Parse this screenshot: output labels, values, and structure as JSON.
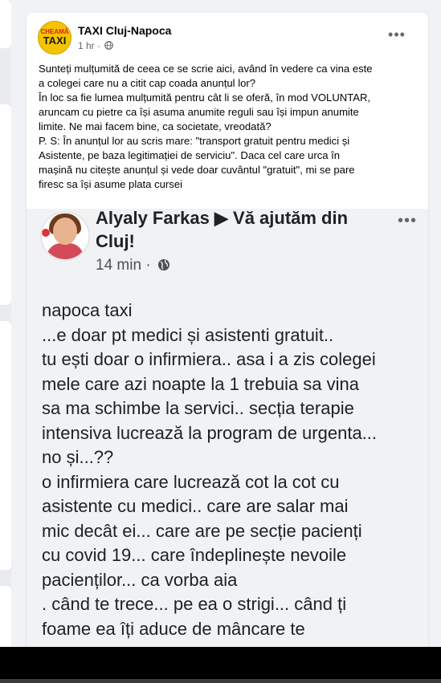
{
  "post": {
    "page_name": "TAXI Cluj-Napoca",
    "time": "1 hr",
    "privacy_icon": "globe-icon",
    "more_icon": "more-horizontal-icon",
    "more_label": "•••",
    "logo": {
      "top_text": "CHEAMĂ",
      "bottom_text": "TAXI",
      "color": "#f5c400"
    },
    "text": "Sunteți mulțumită de ceea ce se scrie aici, având în vedere ca vina este\na colegei care nu a citit cap coada anunțul lor?\nÎn loc sa fie lumea mulțumită pentru cât li se oferă, în mod VOLUNTAR,\naruncam cu pietre ca își asuma anumite reguli sau își impun anumite\nlimite. Ne mai facem bine, ca societate, vreodată?\nP. S: În anunțul lor au scris mare: \"transport gratuit pentru medici și\nAsistente, pe baza legitimației de serviciu\". Daca cel care urca în\nmașină nu citește anunțul și vede doar cuvântul \"gratuit\", mi se pare\nfiresc sa își asume plata cursei"
  },
  "shared": {
    "author_line": "Alyaly Farkas ▶ Vă ajutăm din\nCluj!",
    "time": "14 min",
    "separator": "·",
    "more_label": "•••",
    "privacy_icon": "globe-icon",
    "text": "napoca taxi\n...e doar pt medici și asistenti gratuit..\ntu ești doar o infirmiera.. asa i a zis colegei\nmele care azi noapte la 1   trebuia sa vina\nsa ma schimbe la servici.. secția terapie\nintensiva lucrează la program de urgenta...\nno și...??\n o infirmiera care lucrează cot la cot cu\nasistente cu medici.. care are salar mai\nmic decât ei... care   are pe secție pacienți\ncu covid 19... care îndeplinește nevoile\npacienților... ca vorba aia\n. când te trece... pe ea o strigi... când ți\nfoame ea îți aduce de mâncare   te"
  },
  "colors": {
    "background": "#f0f2f5",
    "card": "#ffffff",
    "text": "#050505",
    "muted": "#65676b"
  }
}
